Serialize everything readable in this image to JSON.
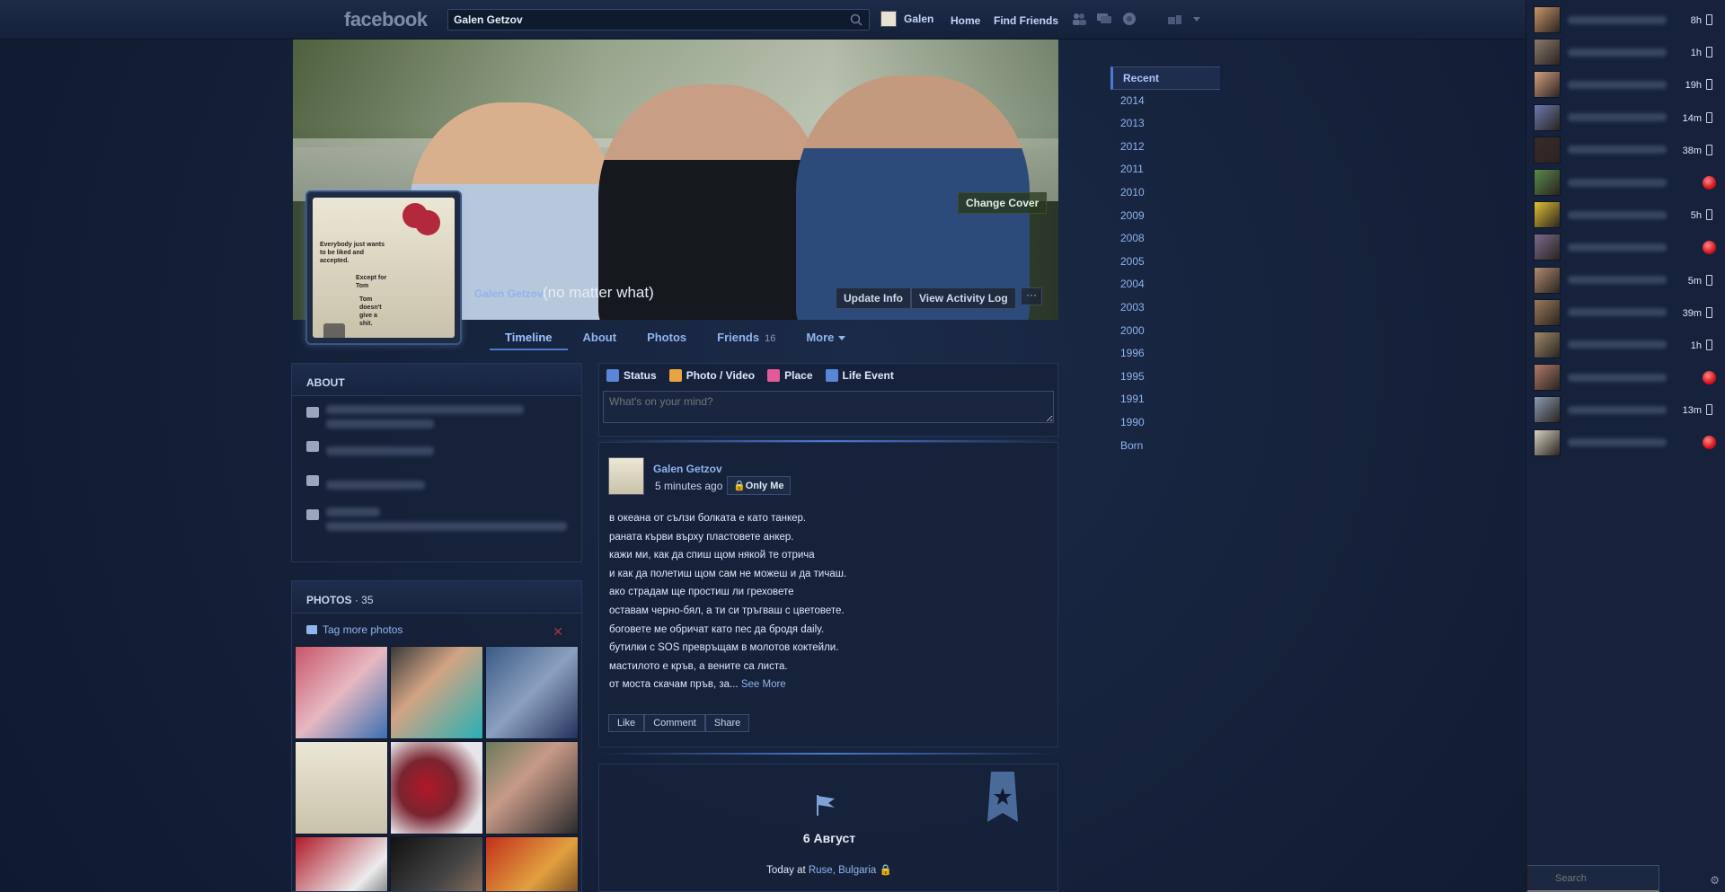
{
  "topbar": {
    "logo": "facebook",
    "search_value": "Galen Getzov",
    "user_name": "Galen",
    "home": "Home",
    "find_friends": "Find Friends"
  },
  "cover": {
    "change_cover": "Change Cover",
    "profile_name": "Galen Getzov",
    "profile_subtitle": "(no matter what)",
    "update_info": "Update Info",
    "view_activity_log": "View Activity Log",
    "more": "···",
    "pic_text": "Everybody just wants to be liked and accepted.",
    "pic_text_2": "Except for Tom",
    "pic_text_3": "Tom doesn't give a shit."
  },
  "tabs": {
    "timeline": "Timeline",
    "about": "About",
    "photos": "Photos",
    "friends": "Friends",
    "friends_count": "16",
    "more": "More"
  },
  "about": {
    "title": "ABOUT"
  },
  "photos": {
    "title": "PHOTOS",
    "count": "· 35",
    "tag_more": "Tag more photos"
  },
  "composer": {
    "status": "Status",
    "photo_video": "Photo / Video",
    "place": "Place",
    "life_event": "Life Event",
    "placeholder": "What's on your mind?"
  },
  "post": {
    "author": "Galen Getzov",
    "time": "5 minutes ago",
    "privacy": "Only Me",
    "lines": [
      "в океана от сълзи болката е като танкер.",
      "раната кърви върху пластовете анкер.",
      "кажи ми, как да спиш щом някой те отрича",
      "и как да полетиш щом сам не можеш и да тичаш.",
      "ако страдам ще простиш ли греховете",
      "оставам черно-бял, а ти си тръгваш с цветовете.",
      "боговете ме обричат като пес да бродя daily.",
      "бутилки с SOS превръщам в молотов коктейли.",
      "мастилото е кръв, а вените са листа."
    ],
    "last_line": "от моста скачам пръв, за...",
    "see_more": "See More",
    "like": "Like",
    "comment": "Comment",
    "share": "Share"
  },
  "life_event": {
    "title": "6 Август",
    "when": "Today",
    "at": "at",
    "place": "Ruse, Bulgaria"
  },
  "timeline_years": [
    "Recent",
    "2014",
    "2013",
    "2012",
    "2011",
    "2010",
    "2009",
    "2008",
    "2005",
    "2004",
    "2003",
    "2000",
    "1996",
    "1995",
    "1991",
    "1990",
    "Born"
  ],
  "chat": {
    "items": [
      {
        "time": "8h",
        "status": "mobile"
      },
      {
        "time": "1h",
        "status": "mobile"
      },
      {
        "time": "19h",
        "status": "mobile"
      },
      {
        "time": "14m",
        "status": "mobile"
      },
      {
        "time": "38m",
        "status": "mobile"
      },
      {
        "time": "",
        "status": "offline"
      },
      {
        "time": "5h",
        "status": "mobile"
      },
      {
        "time": "",
        "status": "offline"
      },
      {
        "time": "5m",
        "status": "mobile"
      },
      {
        "time": "39m",
        "status": "mobile"
      },
      {
        "time": "1h",
        "status": "mobile"
      },
      {
        "time": "",
        "status": "offline"
      },
      {
        "time": "13m",
        "status": "mobile"
      },
      {
        "time": "",
        "status": "offline"
      }
    ],
    "search_placeholder": "Search"
  },
  "colors": {
    "background": "#15213a",
    "link": "#8fb4ee",
    "accent": "#4a7bd0",
    "offline_dot": "#d8141c"
  }
}
